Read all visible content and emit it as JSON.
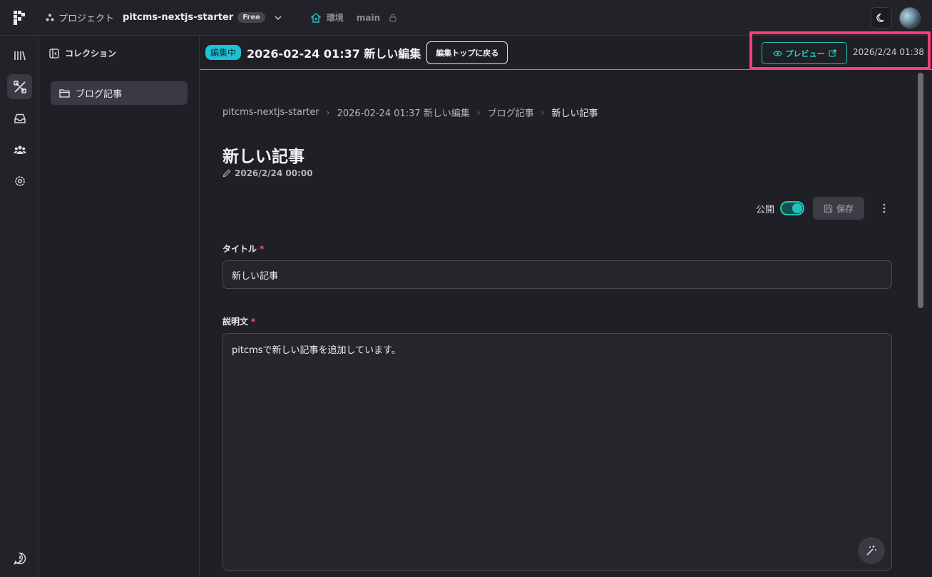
{
  "topbar": {
    "project_label": "プロジェクト",
    "project_name": "pitcms-nextjs-starter",
    "plan_badge": "Free",
    "env_label": "環境",
    "branch": "main"
  },
  "rail": {
    "items": [
      "library-icon",
      "tools-icon",
      "inbox-icon",
      "users-icon",
      "settings-icon"
    ],
    "bottom": "feedback-icon"
  },
  "collections": {
    "heading": "コレクション",
    "items": [
      {
        "label": "ブログ記事"
      }
    ]
  },
  "edit_header": {
    "status_badge": "編集中",
    "title": "2026-02-24 01:37 新しい編集",
    "back_label": "編集トップに戻る",
    "preview_label": "プレビュー",
    "timestamp": "2026/2/24 01:38"
  },
  "breadcrumb": [
    "pitcms-nextjs-starter",
    "2026-02-24 01:37 新しい編集",
    "ブログ記事",
    "新しい記事"
  ],
  "entry": {
    "title": "新しい記事",
    "date": "2026/2/24 00:00",
    "publish_label": "公開",
    "publish_on": true,
    "save_label": "保存"
  },
  "fields": {
    "title_label": "タイトル",
    "title_value": "新しい記事",
    "desc_label": "説明文",
    "desc_value": "pitcmsで新しい記事を追加しています。",
    "required_mark": "*"
  },
  "colors": {
    "accent": "#23c4b8",
    "highlight": "#ff3d7a",
    "badge": "#1cc2d6"
  }
}
